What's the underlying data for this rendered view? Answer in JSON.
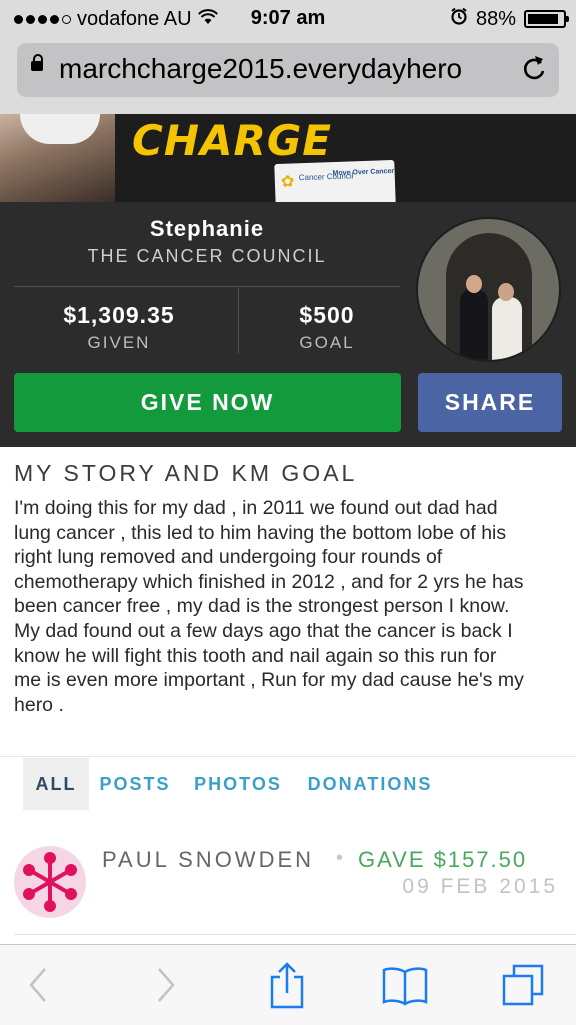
{
  "status_bar": {
    "carrier": "vodafone AU",
    "time": "9:07 am",
    "battery": "88%",
    "battery_level": 0.88
  },
  "browser": {
    "url": "marchcharge2015.everydayhero"
  },
  "banner": {
    "headline": "CHARGE",
    "sponsor_logo_text": "Cancer Council",
    "sponsor_tagline": "Move Over Cancer"
  },
  "profile": {
    "name": "Stephanie",
    "organisation": "THE CANCER COUNCIL",
    "given_amount": "$1,309.35",
    "given_label": "GIVEN",
    "goal_amount": "$500",
    "goal_label": "GOAL",
    "give_button": "GIVE NOW",
    "share_button": "SHARE"
  },
  "story": {
    "title": "MY STORY AND KM GOAL",
    "body": "I'm doing this for my dad , in 2011 we found out dad had\nlung cancer , this led to him having the bottom lobe  of his\nright lung removed and undergoing four rounds of\nchemotherapy which finished in 2012 , and for 2 yrs he has\nbeen cancer free , my dad is the strongest  person I know.\nMy dad found out a few days ago that the cancer is back  I\nknow he will fight this tooth and nail again so this run for\nme is even more important , Run for my dad cause he's my\nhero ."
  },
  "tabs": [
    {
      "label": "ALL",
      "active": true
    },
    {
      "label": "POSTS",
      "active": false
    },
    {
      "label": "PHOTOS",
      "active": false
    },
    {
      "label": "DONATIONS",
      "active": false
    }
  ],
  "activity": [
    {
      "name": "PAUL SNOWDEN",
      "separator": "•",
      "action": "GAVE $157.50",
      "date": "09 FEB 2015"
    }
  ],
  "toolbar": {
    "icons": [
      "back-icon",
      "forward-icon",
      "share-icon",
      "bookmarks-icon",
      "tabs-icon"
    ]
  },
  "colors": {
    "give_green": "#139a3d",
    "share_blue": "#4b64a4",
    "tab_blue": "#3aa0c8",
    "panel_dark": "#2c2c2c",
    "donation_green": "#4aa85d",
    "banner_yellow": "#f5c400"
  }
}
